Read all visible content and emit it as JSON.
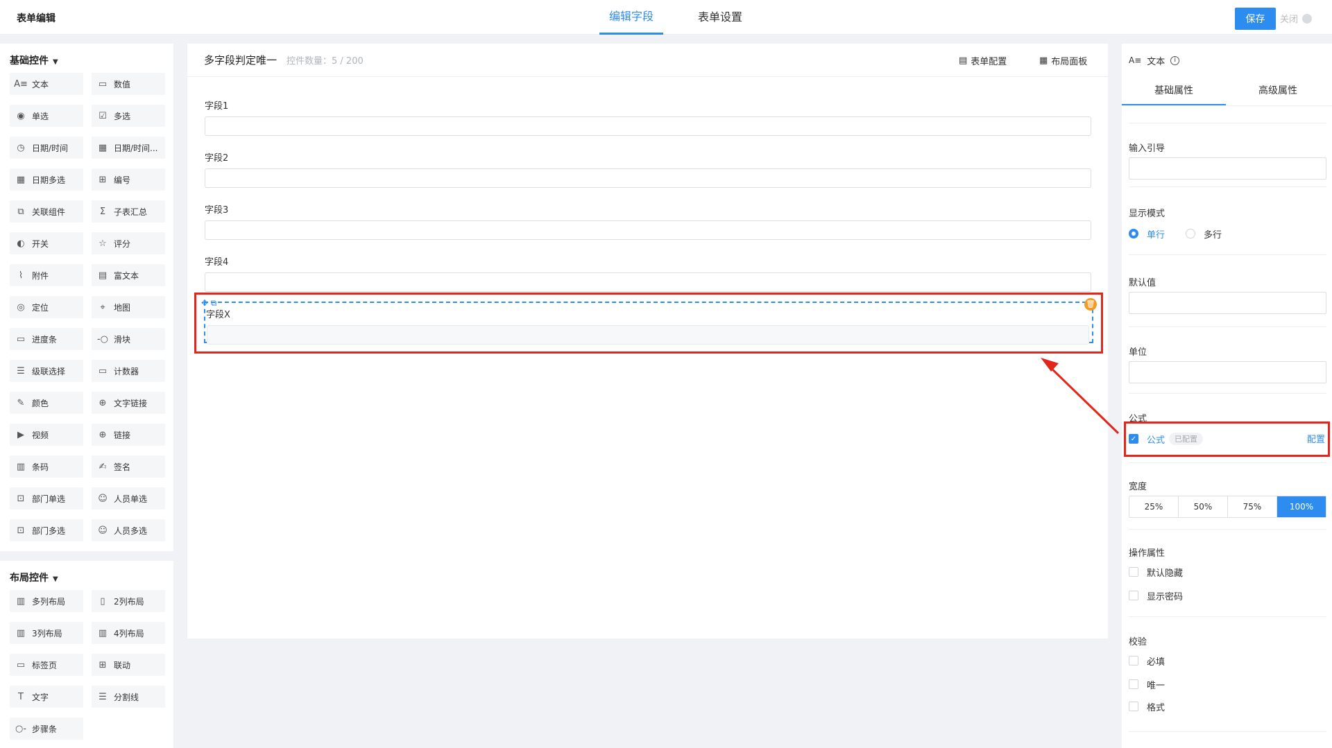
{
  "header": {
    "title": "表单编辑",
    "tabs": [
      "编辑字段",
      "表单设置"
    ],
    "save": "保存",
    "close": "关闭"
  },
  "left": {
    "basic_title": "基础控件",
    "basic": [
      {
        "icon": "text-icon",
        "glyph": "A≡",
        "label": "文本"
      },
      {
        "icon": "number-icon",
        "glyph": "▭",
        "label": "数值"
      },
      {
        "icon": "radio-icon",
        "glyph": "◉",
        "label": "单选"
      },
      {
        "icon": "checkbox-icon",
        "glyph": "☑",
        "label": "多选"
      },
      {
        "icon": "clock-icon",
        "glyph": "◷",
        "label": "日期/时间"
      },
      {
        "icon": "calendar-icon",
        "glyph": "▦",
        "label": "日期/时间..."
      },
      {
        "icon": "calendar-multi-icon",
        "glyph": "▦",
        "label": "日期多选"
      },
      {
        "icon": "serial-icon",
        "glyph": "⊞",
        "label": "编号"
      },
      {
        "icon": "link-component-icon",
        "glyph": "⧉",
        "label": "关联组件"
      },
      {
        "icon": "sigma-icon",
        "glyph": "Σ",
        "label": "子表汇总"
      },
      {
        "icon": "toggle-icon",
        "glyph": "◐",
        "label": "开关"
      },
      {
        "icon": "star-icon",
        "glyph": "☆",
        "label": "评分"
      },
      {
        "icon": "attachment-icon",
        "glyph": "⌇",
        "label": "附件"
      },
      {
        "icon": "richtext-icon",
        "glyph": "▤",
        "label": "富文本"
      },
      {
        "icon": "location-icon",
        "glyph": "◎",
        "label": "定位"
      },
      {
        "icon": "map-icon",
        "glyph": "⌖",
        "label": "地图"
      },
      {
        "icon": "progress-icon",
        "glyph": "▭",
        "label": "进度条"
      },
      {
        "icon": "slider-icon",
        "glyph": "-○",
        "label": "滑块"
      },
      {
        "icon": "cascade-icon",
        "glyph": "☰",
        "label": "级联选择"
      },
      {
        "icon": "counter-icon",
        "glyph": "▭",
        "label": "计数器"
      },
      {
        "icon": "color-icon",
        "glyph": "✎",
        "label": "颜色"
      },
      {
        "icon": "globe-icon",
        "glyph": "⊕",
        "label": "文字链接"
      },
      {
        "icon": "video-icon",
        "glyph": "▶",
        "label": "视频"
      },
      {
        "icon": "globe-link-icon",
        "glyph": "⊕",
        "label": "链接"
      },
      {
        "icon": "barcode-icon",
        "glyph": "▥",
        "label": "条码"
      },
      {
        "icon": "signature-icon",
        "glyph": "✍",
        "label": "签名"
      },
      {
        "icon": "dept-icon",
        "glyph": "⊡",
        "label": "部门单选"
      },
      {
        "icon": "user-icon",
        "glyph": "☺",
        "label": "人员单选"
      },
      {
        "icon": "dept-multi-icon",
        "glyph": "⊡",
        "label": "部门多选"
      },
      {
        "icon": "users-icon",
        "glyph": "☺",
        "label": "人员多选"
      }
    ],
    "layout_title": "布局控件",
    "layout": [
      {
        "icon": "multi-col-icon",
        "glyph": "▥",
        "label": "多列布局"
      },
      {
        "icon": "two-col-icon",
        "glyph": "▯",
        "label": "2列布局"
      },
      {
        "icon": "three-col-icon",
        "glyph": "▥",
        "label": "3列布局"
      },
      {
        "icon": "four-col-icon",
        "glyph": "▥",
        "label": "4列布局"
      },
      {
        "icon": "tab-page-icon",
        "glyph": "▭",
        "label": "标签页"
      },
      {
        "icon": "linkage-icon",
        "glyph": "⊞",
        "label": "联动"
      },
      {
        "icon": "text-t-icon",
        "glyph": "T",
        "label": "文字"
      },
      {
        "icon": "divider-icon",
        "glyph": "☰",
        "label": "分割线"
      },
      {
        "icon": "steps-icon",
        "glyph": "○-",
        "label": "步骤条"
      }
    ]
  },
  "canvas": {
    "title": "多字段判定唯一",
    "count": "控件数量：5 / 200",
    "form_config": "表单配置",
    "layout_panel": "布局面板",
    "fields": [
      "字段1",
      "字段2",
      "字段3",
      "字段4",
      "字段X"
    ]
  },
  "right": {
    "type": "文本",
    "tabs": [
      "基础属性",
      "高级属性"
    ],
    "input_guide": "输入引导",
    "display_mode": "显示模式",
    "single": "单行",
    "multi": "多行",
    "default": "默认值",
    "unit": "单位",
    "formula_title": "公式",
    "formula_label": "公式",
    "formula_badge": "已配置",
    "formula_config": "配置",
    "width_title": "宽度",
    "widths": [
      "25%",
      "50%",
      "75%",
      "100%"
    ],
    "width_selected": "100%",
    "ops_title": "操作属性",
    "ops": [
      "默认隐藏",
      "显示密码"
    ],
    "validate_title": "校验",
    "validate": [
      "必填",
      "唯一",
      "格式"
    ]
  },
  "colors": {
    "accent": "#2d8cf0",
    "highlight": "#e1261c",
    "delete": "#f59a23"
  }
}
